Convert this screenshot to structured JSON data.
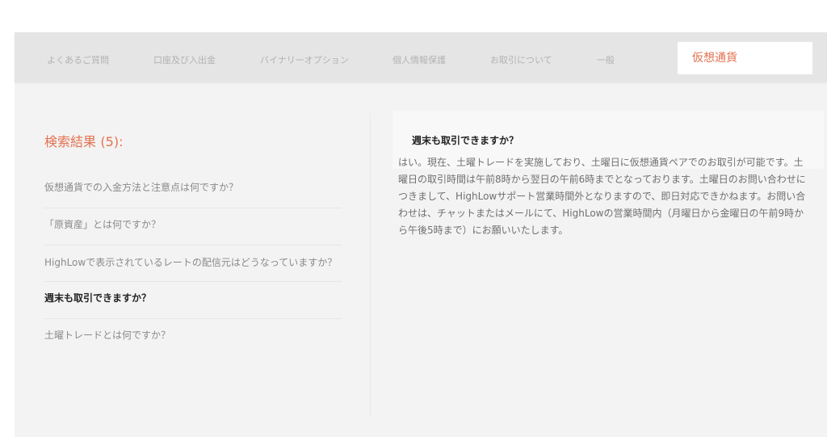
{
  "tabs": [
    {
      "label": "よくあるご質問"
    },
    {
      "label": "口座及び入出金"
    },
    {
      "label": "バイナリーオプション"
    },
    {
      "label": "個人情報保護"
    },
    {
      "label": "お取引について"
    },
    {
      "label": "一般"
    },
    {
      "label": "仮想通貨",
      "active": true
    }
  ],
  "results": {
    "title": "検索結果",
    "count": "(5):"
  },
  "questions": [
    {
      "text": "仮想通貨での入金方法と注意点は何ですか？"
    },
    {
      "text": "「原資産」とは何ですか？"
    },
    {
      "text": "HighLowで表示されているレートの配信元はどうなっていますか？"
    },
    {
      "text": "週末も取引できますか？",
      "active": true
    },
    {
      "text": "土曜トレードとは何ですか？"
    }
  ],
  "answer": {
    "title": "週末も取引できますか？",
    "body": "はい。現在、土曜トレードを実施しており、土曜日に仮想通貨ペアでのお取引が可能です。土曜日の取引時間は午前8時から翌日の午前6時までとなっております。土曜日のお問い合わせにつきまして、HighLowサポート営業時間外となりますので、即日対応できかねます。お問い合わせは、チャットまたはメールにて、HighLowの営業時間内（月曜日から金曜日の午前9時から午後5時まで）にお願いいたします。"
  },
  "colors": {
    "accent": "#e3724f",
    "tabbar_bg": "#e5e5e5",
    "panel_bg": "#f3f3f3"
  }
}
